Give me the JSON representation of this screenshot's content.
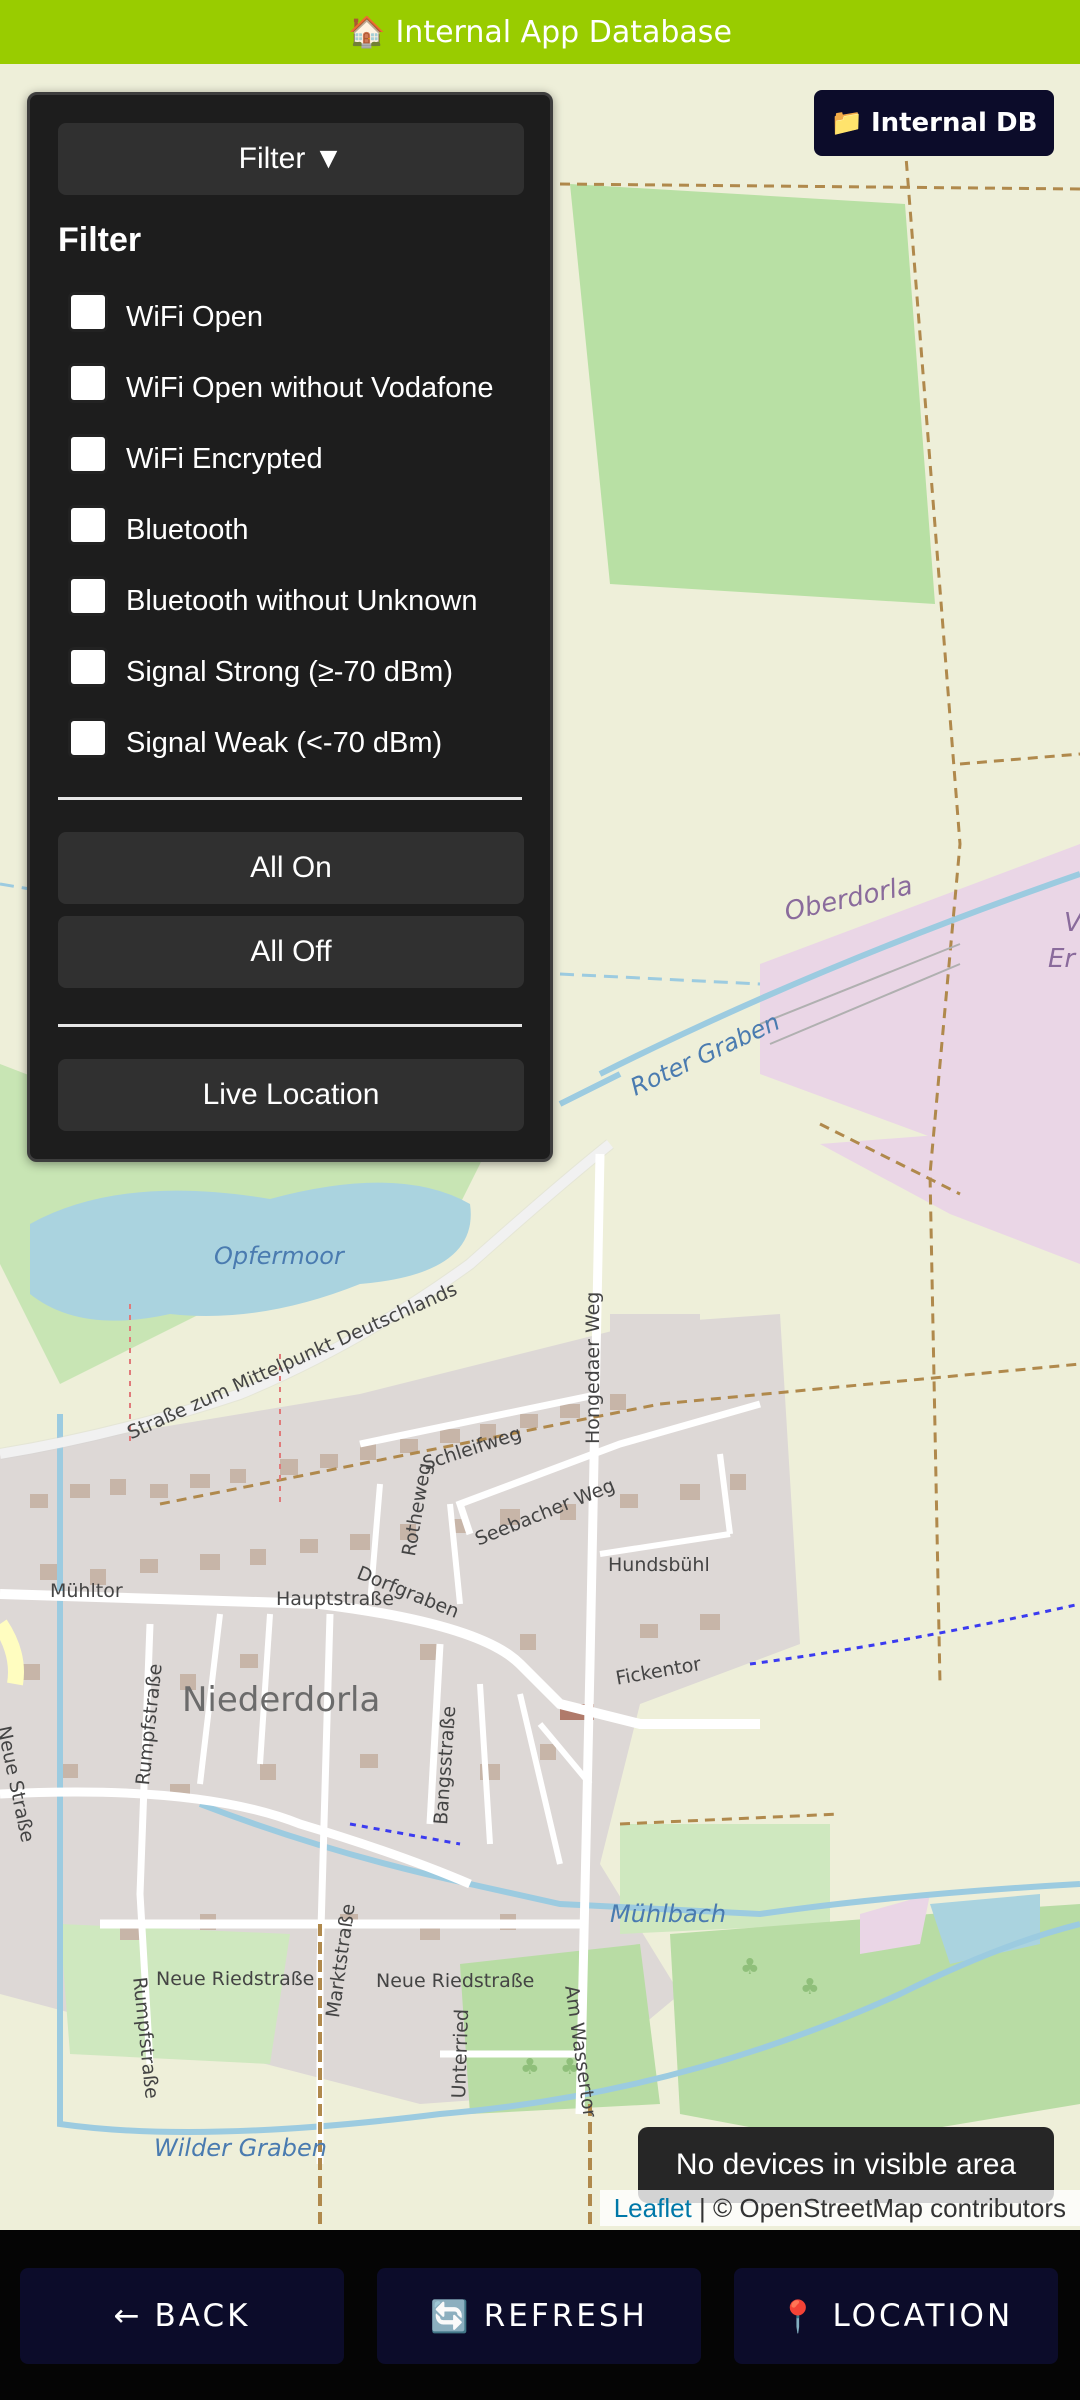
{
  "header": {
    "icon": "🏠",
    "title": "Internal App Database"
  },
  "db_button": {
    "icon": "📁",
    "label": "Internal DB"
  },
  "filter_panel": {
    "toggle_label": "Filter ▼",
    "title": "Filter",
    "options": [
      {
        "label": "WiFi Open",
        "checked": false
      },
      {
        "label": "WiFi Open without Vodafone",
        "checked": false
      },
      {
        "label": "WiFi Encrypted",
        "checked": false
      },
      {
        "label": "Bluetooth",
        "checked": false
      },
      {
        "label": "Bluetooth without Unknown",
        "checked": false
      },
      {
        "label": "Signal Strong (≥-70 dBm)",
        "checked": false
      },
      {
        "label": "Signal Weak (<-70 dBm)",
        "checked": false
      }
    ],
    "all_on_label": "All On",
    "all_off_label": "All Off",
    "live_location_label": "Live Location"
  },
  "map": {
    "labels": {
      "niederdorla": "Niederdorla",
      "oberdorla": "Oberdorla",
      "opfermoor": "Opfermoor",
      "roter_graben": "Roter Graben",
      "muehlbach": "Mühlbach",
      "wilder_graben": "Wilder Graben",
      "strasse_mittelpunkt": "Straße zum Mittelpunkt Deutschlands",
      "schleifweg": "Schleifweg",
      "hongedaer_weg": "Hongedaer Weg",
      "seebacher_weg": "Seebacher Weg",
      "rotheweg": "Rotheweg",
      "hundsbuehl": "Hundsbühl",
      "muehltor": "Mühltor",
      "hauptstrasse": "Hauptstraße",
      "dorfgraben": "Dorfgraben",
      "fickentor": "Fickentor",
      "neue_strasse": "Neue Straße",
      "rumpfstrasse": "Rumpfstraße",
      "rumpfstrasse2": "Rumpfstraße",
      "marktstrasse": "Marktstraße",
      "bangsstrasse": "Bangsstraße",
      "neue_riedstrasse_1": "Neue Riedstraße",
      "neue_riedstrasse_2": "Neue Riedstraße",
      "unterried": "Unterried",
      "am_wassertor": "Am Wassertor",
      "edge_v": "V",
      "edge_er": "Er"
    }
  },
  "toast": "No devices in visible area",
  "attribution": {
    "leaflet": "Leaflet",
    "separator": " | ",
    "osm": "© OpenStreetMap contributors"
  },
  "bottom_bar": {
    "back": {
      "icon": "←",
      "label": "BACK"
    },
    "refresh": {
      "icon": "🔄",
      "label": "REFRESH"
    },
    "location": {
      "icon": "📍",
      "label": "LOCATION"
    }
  }
}
